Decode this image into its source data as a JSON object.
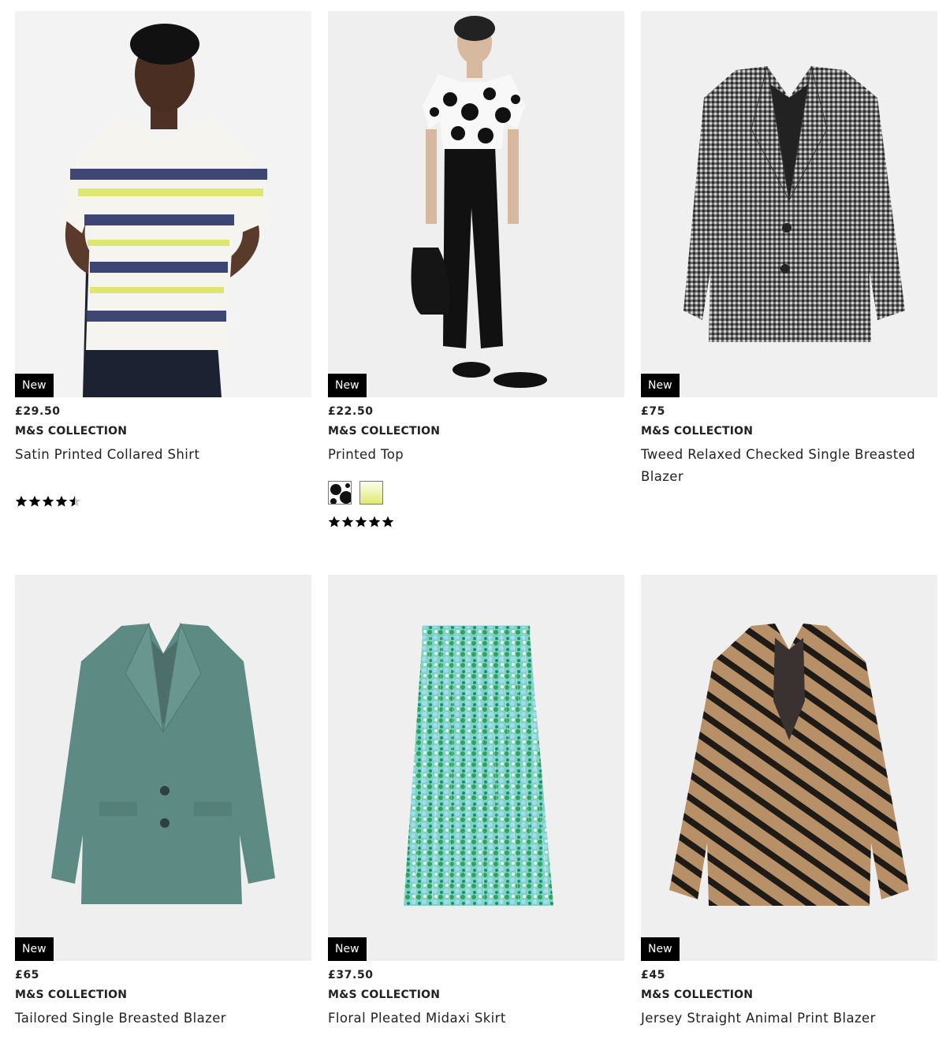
{
  "products": [
    {
      "badge": "New",
      "price": "£29.50",
      "brand": "M&S COLLECTION",
      "name": "Satin Printed Collared Shirt",
      "rating": 4.5
    },
    {
      "badge": "New",
      "price": "£22.50",
      "brand": "M&S COLLECTION",
      "name": "Printed Top",
      "rating": 5,
      "swatches": [
        "black-white-spot",
        "lime-ombre"
      ]
    },
    {
      "badge": "New",
      "price": "£75",
      "brand": "M&S COLLECTION",
      "name": "Tweed Relaxed Checked Single Breasted Blazer"
    },
    {
      "badge": "New",
      "price": "£65",
      "brand": "M&S COLLECTION",
      "name": "Tailored Single Breasted Blazer"
    },
    {
      "badge": "New",
      "price": "£37.50",
      "brand": "M&S COLLECTION",
      "name": "Floral Pleated Midaxi Skirt"
    },
    {
      "badge": "New",
      "price": "£45",
      "brand": "M&S COLLECTION",
      "name": "Jersey Straight Animal Print Blazer"
    }
  ],
  "colors": {
    "badge_bg": "#000000",
    "image_bg": "#efefef",
    "star": "#000000",
    "star_empty": "#c8c8c8"
  }
}
